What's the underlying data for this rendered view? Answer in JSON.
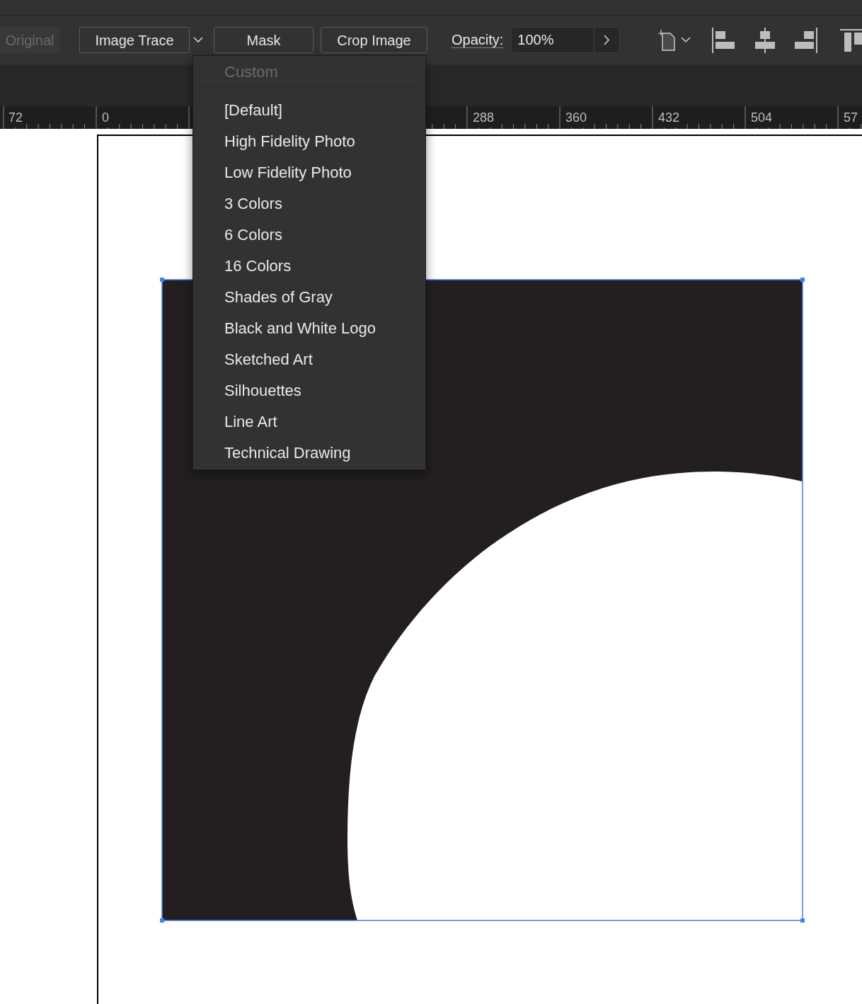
{
  "toolbar": {
    "buttons": [
      {
        "label": "Original",
        "disabled": true,
        "dropdown": false
      },
      {
        "label": "Image Trace",
        "disabled": false,
        "dropdown": true
      },
      {
        "label": "Mask",
        "disabled": false,
        "dropdown": false
      },
      {
        "label": "Crop Image",
        "disabled": false,
        "dropdown": false
      }
    ],
    "opacity": {
      "label": "Opacity:",
      "value": "100%"
    }
  },
  "ruler": {
    "labels": [
      "72",
      "0",
      "288",
      "360",
      "432",
      "504",
      "57"
    ]
  },
  "trace_preset_menu": {
    "items": [
      {
        "label": "Custom",
        "disabled": true
      },
      {
        "label": "[Default]",
        "disabled": false
      },
      {
        "label": "High Fidelity Photo",
        "disabled": false
      },
      {
        "label": "Low Fidelity Photo",
        "disabled": false
      },
      {
        "label": "3 Colors",
        "disabled": false
      },
      {
        "label": "6 Colors",
        "disabled": false
      },
      {
        "label": "16 Colors",
        "disabled": false
      },
      {
        "label": "Shades of Gray",
        "disabled": false
      },
      {
        "label": "Black and White Logo",
        "disabled": false
      },
      {
        "label": "Sketched Art",
        "disabled": false
      },
      {
        "label": "Silhouettes",
        "disabled": false
      },
      {
        "label": "Line Art",
        "disabled": false
      },
      {
        "label": "Technical Drawing",
        "disabled": false
      }
    ]
  }
}
